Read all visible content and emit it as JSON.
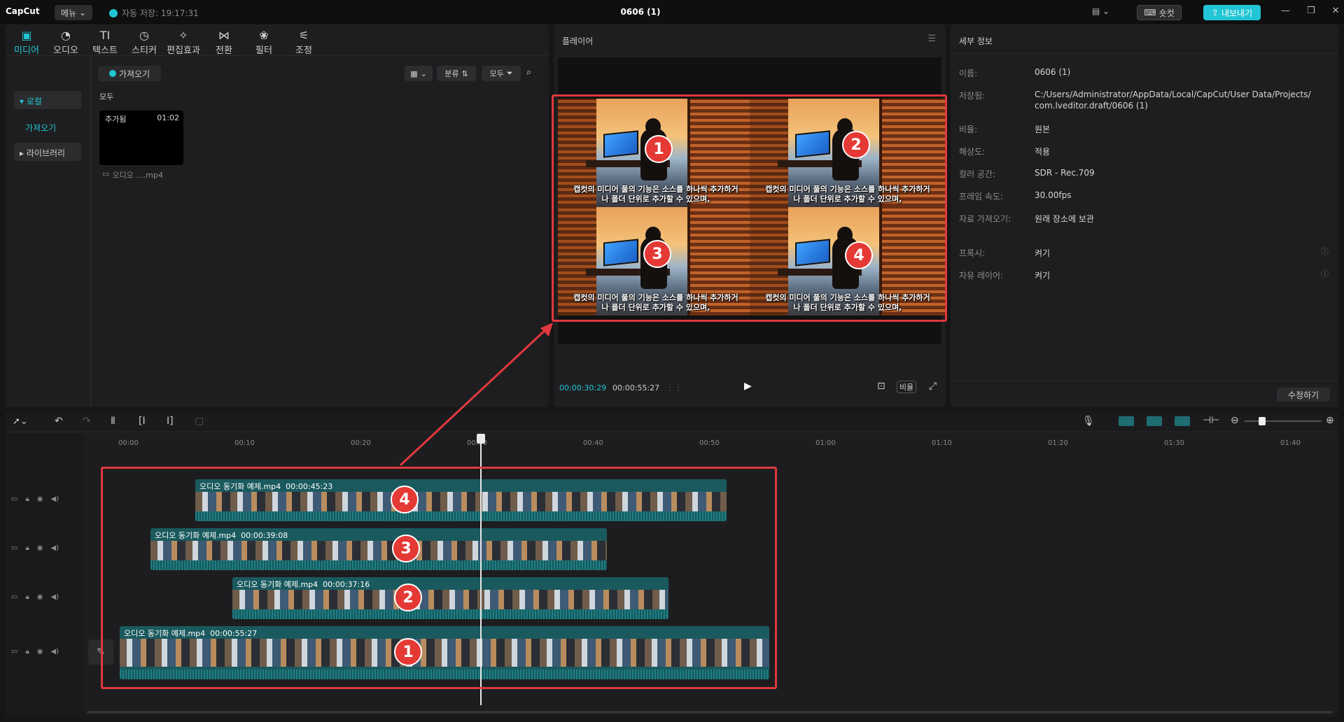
{
  "app": {
    "logo": "CapCut",
    "menu": "메뉴",
    "autosave": "자동 저장: 19:17:31",
    "title": "0606 (1)",
    "shortcut": "숏컷",
    "export": "내보내기"
  },
  "toolbar": [
    {
      "label": "미디어",
      "icon": "media-icon"
    },
    {
      "label": "오디오",
      "icon": "audio-icon"
    },
    {
      "label": "텍스트",
      "icon": "text-icon"
    },
    {
      "label": "스티커",
      "icon": "sticker-icon"
    },
    {
      "label": "편집효과",
      "icon": "effects-icon"
    },
    {
      "label": "전환",
      "icon": "transition-icon"
    },
    {
      "label": "필터",
      "icon": "filter-icon"
    },
    {
      "label": "조정",
      "icon": "adjust-icon"
    }
  ],
  "sidebar": {
    "local": "로컬",
    "import": "가져오기",
    "library": "라이브러리"
  },
  "media": {
    "import_btn": "가져오기",
    "sort_label": "분류",
    "filter_label": "모두",
    "all_label": "모두",
    "item_badge": "추가됨",
    "item_duration": "01:02",
    "item_name": "오디오 ....mp4"
  },
  "player": {
    "title": "플레이어",
    "current_time": "00:00:30:29",
    "total_time": "00:00:55:27",
    "ratio_btn": "비율",
    "subtitle_line1": "캡컷의 미디어 풀의 기능은 소스를 하나씩 추가하거",
    "subtitle_line2": "나 폴더 단위로 추가할 수 있으며,",
    "badges": [
      "1",
      "2",
      "3",
      "4"
    ]
  },
  "details": {
    "title": "세부 정보",
    "rows": [
      {
        "label": "이름:",
        "value": "0606 (1)"
      },
      {
        "label": "저장됨:",
        "value": "C:/Users/Administrator/AppData/Local/CapCut/User Data/Projects/",
        "value2": "com.lveditor.draft/0606 (1)"
      },
      {
        "label": "비율:",
        "value": "원본"
      },
      {
        "label": "해상도:",
        "value": "적용"
      },
      {
        "label": "컬러 공간:",
        "value": "SDR - Rec.709"
      },
      {
        "label": "프레임 속도:",
        "value": "30.00fps"
      },
      {
        "label": "자료 가져오기:",
        "value": "원래 장소에 보관"
      },
      {
        "label": "프록시:",
        "value": "켜기"
      },
      {
        "label": "자유 레이어:",
        "value": "켜기"
      }
    ],
    "modify_btn": "수정하기"
  },
  "timeline": {
    "ticks": [
      "00:00",
      "00:10",
      "00:20",
      "00:30",
      "00:40",
      "00:50",
      "01:00",
      "01:10",
      "01:20",
      "01:30",
      "01:40"
    ],
    "clips": [
      {
        "name": "오디오 동기화 예제.mp4",
        "duration": "00:00:45:23",
        "badge": "4"
      },
      {
        "name": "오디오 동기화 예제.mp4",
        "duration": "00:00:39:08",
        "badge": "3"
      },
      {
        "name": "오디오 동기화 예제.mp4",
        "duration": "00:00:37:16",
        "badge": "2"
      },
      {
        "name": "오디오 동기화 예제.mp4",
        "duration": "00:00:55:27",
        "badge": "1"
      }
    ]
  },
  "colors": {
    "accent": "#21c5d3",
    "highlight": "#e0383e",
    "clip": "#1a5a5e"
  }
}
